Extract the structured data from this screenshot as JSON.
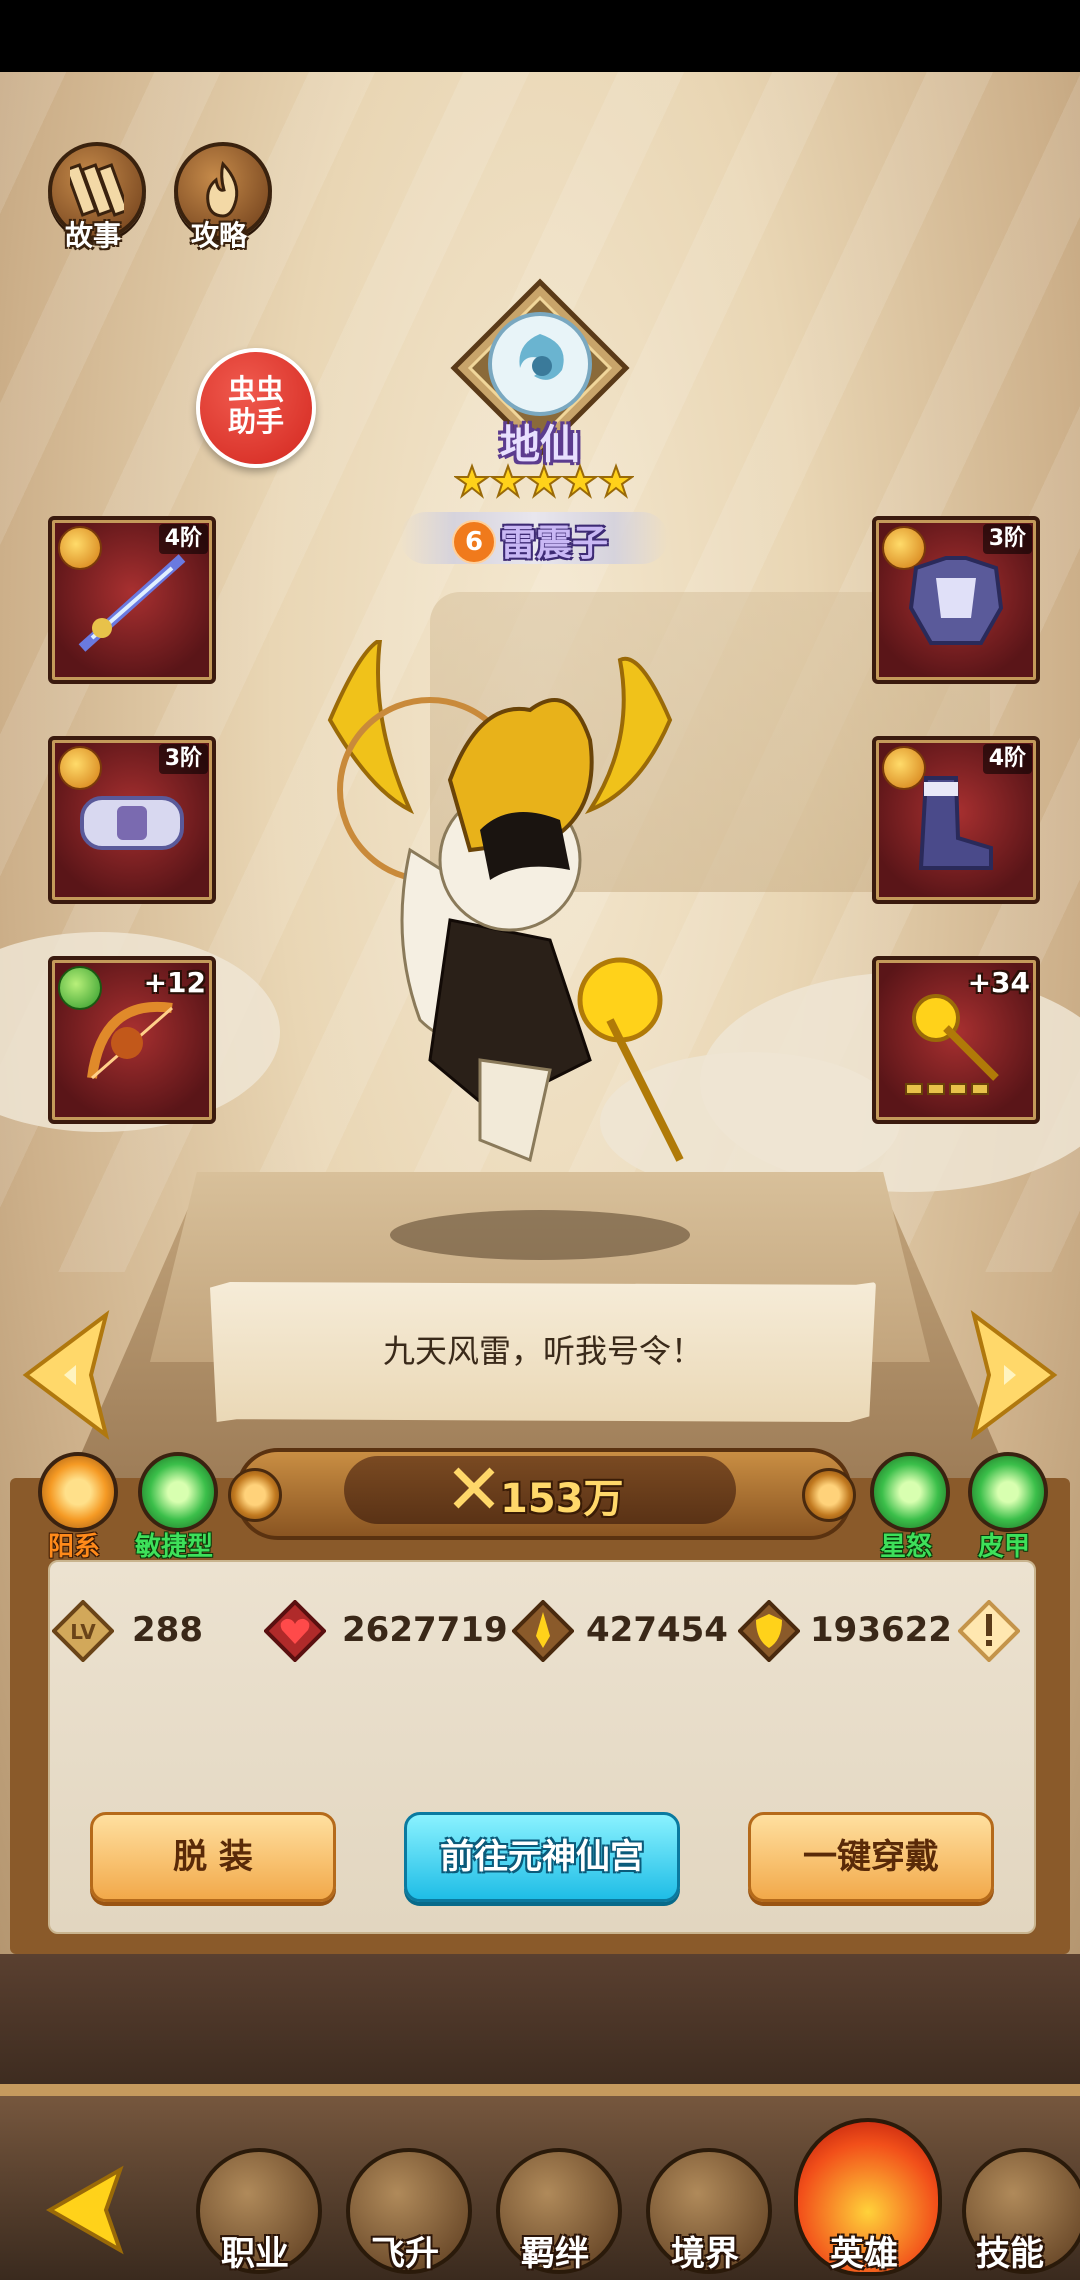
{
  "top_buttons": [
    {
      "label": "故事",
      "icon": "book-icon"
    },
    {
      "label": "攻略",
      "icon": "flame-icon"
    }
  ],
  "helper": {
    "line1": "虫虫",
    "line2": "助手"
  },
  "hero": {
    "rank": "地仙",
    "stars": 5,
    "number": "6",
    "name": "雷震子"
  },
  "equipment": {
    "left": [
      {
        "tier": "4阶",
        "item": "sword-icon"
      },
      {
        "tier": "3阶",
        "item": "belt-icon"
      },
      {
        "tier": "+12",
        "item": "bow-icon"
      }
    ],
    "right": [
      {
        "tier": "3阶",
        "item": "armor-icon"
      },
      {
        "tier": "4阶",
        "item": "boots-icon"
      },
      {
        "tier": "+34",
        "item": "hammer-icon"
      }
    ]
  },
  "speech": "九天风雷，听我号令！",
  "traits": {
    "left": [
      {
        "label": "阳系",
        "color": "#ff8a1a"
      },
      {
        "label": "敏捷型",
        "color": "#3ee05a"
      }
    ],
    "right": [
      {
        "label": "星怒",
        "color": "#3ee05a"
      },
      {
        "label": "皮甲",
        "color": "#3ee05a"
      }
    ]
  },
  "power": "153万",
  "stats": {
    "level_label": "LV",
    "level": "288",
    "hp": "2627719",
    "attack": "427454",
    "defense": "193622"
  },
  "actions": {
    "unequip": "脱 装",
    "goto": "前往元神仙宫",
    "equip_all": "一键穿戴"
  },
  "bottom_nav": [
    {
      "label": "职业",
      "icon": "book-icon"
    },
    {
      "label": "飞升",
      "icon": "cloud-icon"
    },
    {
      "label": "羁绊",
      "icon": "bond-icon"
    },
    {
      "label": "境界",
      "icon": "skull-icon"
    },
    {
      "label": "英雄",
      "icon": "flame-icon",
      "active": true
    },
    {
      "label": "技能",
      "icon": "sword-icon"
    }
  ]
}
